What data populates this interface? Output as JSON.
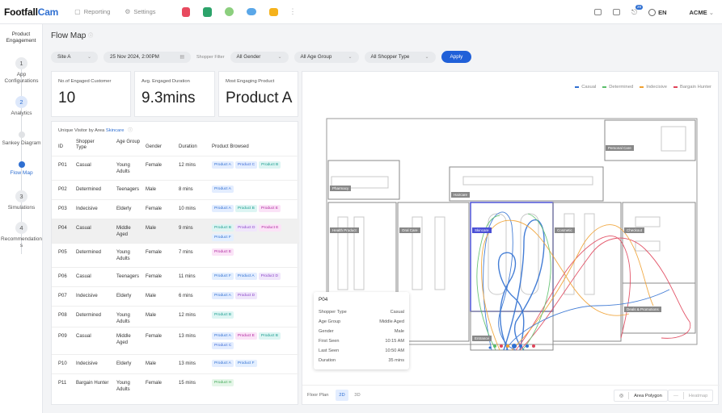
{
  "app": {
    "brand_a": "Footfall",
    "brand_b": "Cam",
    "nav_reporting": "Reporting",
    "nav_settings": "Settings",
    "language": "EN",
    "account": "ACME",
    "notif_count": "29"
  },
  "sidebar": {
    "title": "Product Engagement",
    "steps": [
      {
        "num": "1",
        "label": "App Configurations"
      },
      {
        "num": "2",
        "label": "Analytics"
      },
      {
        "label": "Sankey Diagram"
      },
      {
        "label": "Flow Map"
      },
      {
        "num": "3",
        "label": "Simulations"
      },
      {
        "num": "4",
        "label": "Recommendations"
      }
    ]
  },
  "page": {
    "title": "Flow Map"
  },
  "filters": {
    "site": "Site A",
    "datetime": "25 Nov 2024, 2:00PM",
    "shopper_filter_label": "Shopper Filter",
    "gender": "All Gender",
    "age": "All Age Group",
    "type": "All Shopper Type",
    "apply": "Apply"
  },
  "kpis": [
    {
      "label": "No.of Engaged Customer",
      "value": "10"
    },
    {
      "label": "Avg. Engaged Duration",
      "value": "9.3mins"
    },
    {
      "label": "Most Engaging Product",
      "value": "Product A"
    }
  ],
  "table": {
    "title_prefix": "Unique Visitor by Area",
    "title_area": "Skincare",
    "headers": {
      "id": "ID",
      "type": "Shopper Type",
      "age": "Age Group",
      "gender": "Gender",
      "duration": "Duration",
      "products": "Product Browsed"
    },
    "rows": [
      {
        "id": "P01",
        "type": "Casual",
        "age": "Young Adults",
        "gender": "Female",
        "duration": "12 mins",
        "products": [
          "Product A",
          "Product C",
          "Product B"
        ]
      },
      {
        "id": "P02",
        "type": "Determined",
        "age": "Teenagers",
        "gender": "Male",
        "duration": "8 mins",
        "products": [
          "Product A"
        ]
      },
      {
        "id": "P03",
        "type": "Indecisive",
        "age": "Elderly",
        "gender": "Female",
        "duration": "10 mins",
        "products": [
          "Product A",
          "Product B",
          "Product E"
        ]
      },
      {
        "id": "P04",
        "type": "Casual",
        "age": "Middle Aged",
        "gender": "Male",
        "duration": "9 mins",
        "products": [
          "Product B",
          "Product D",
          "Product E",
          "Product F"
        ]
      },
      {
        "id": "P05",
        "type": "Determined",
        "age": "Young Adults",
        "gender": "Female",
        "duration": "7 mins",
        "products": [
          "Product E"
        ]
      },
      {
        "id": "P06",
        "type": "Casual",
        "age": "Teenagers",
        "gender": "Female",
        "duration": "11 mins",
        "products": [
          "Product F",
          "Product A",
          "Product D"
        ]
      },
      {
        "id": "P07",
        "type": "Indecisive",
        "age": "Elderly",
        "gender": "Male",
        "duration": "6 mins",
        "products": [
          "Product A",
          "Product D"
        ]
      },
      {
        "id": "P08",
        "type": "Determined",
        "age": "Young Adults",
        "gender": "Male",
        "duration": "12 mins",
        "products": [
          "Product B"
        ]
      },
      {
        "id": "P09",
        "type": "Casual",
        "age": "Middle Aged",
        "gender": "Female",
        "duration": "13 mins",
        "products": [
          "Product A",
          "Product E",
          "Product B",
          "Product C"
        ]
      },
      {
        "id": "P10",
        "type": "Indecisive",
        "age": "Elderly",
        "gender": "Male",
        "duration": "13 mins",
        "products": [
          "Product A",
          "Product F"
        ]
      },
      {
        "id": "P11",
        "type": "Bargain Hunter",
        "age": "Young Adults",
        "gender": "Female",
        "duration": "15 mins",
        "products": [
          "Product H"
        ]
      }
    ]
  },
  "legend": [
    {
      "label": "Casual",
      "color": "#2f6fd1"
    },
    {
      "label": "Determined",
      "color": "#5bbf6a"
    },
    {
      "label": "Indecisive",
      "color": "#f0a030"
    },
    {
      "label": "Bargain Hunter",
      "color": "#e0445a"
    }
  ],
  "zones": {
    "personal_care": "Personal Care",
    "pharmacy": "Pharmacy",
    "haircare": "Haircare",
    "health": "Health Product",
    "oral": "Oral Care",
    "skincare": "Skincare",
    "cosmetic": "Cosmetic",
    "checkout": "Checkout",
    "deals": "Deals & Promotions",
    "entrance": "Entrance"
  },
  "tooltip": {
    "id": "P04",
    "rows": [
      {
        "k": "Shopper Type",
        "v": "Casual"
      },
      {
        "k": "Age Group",
        "v": "Middle Aged"
      },
      {
        "k": "Gender",
        "v": "Male"
      },
      {
        "k": "First Seen",
        "v": "10:15 AM"
      },
      {
        "k": "Last Seen",
        "v": "10:50 AM"
      },
      {
        "k": "Duration",
        "v": "35 mins"
      }
    ]
  },
  "map_controls": {
    "floor_plan": "Floor Plan",
    "mode_2d": "2D",
    "mode_3d": "3D",
    "area_polygon": "Area Polygon",
    "heatmap": "Heatmap"
  }
}
